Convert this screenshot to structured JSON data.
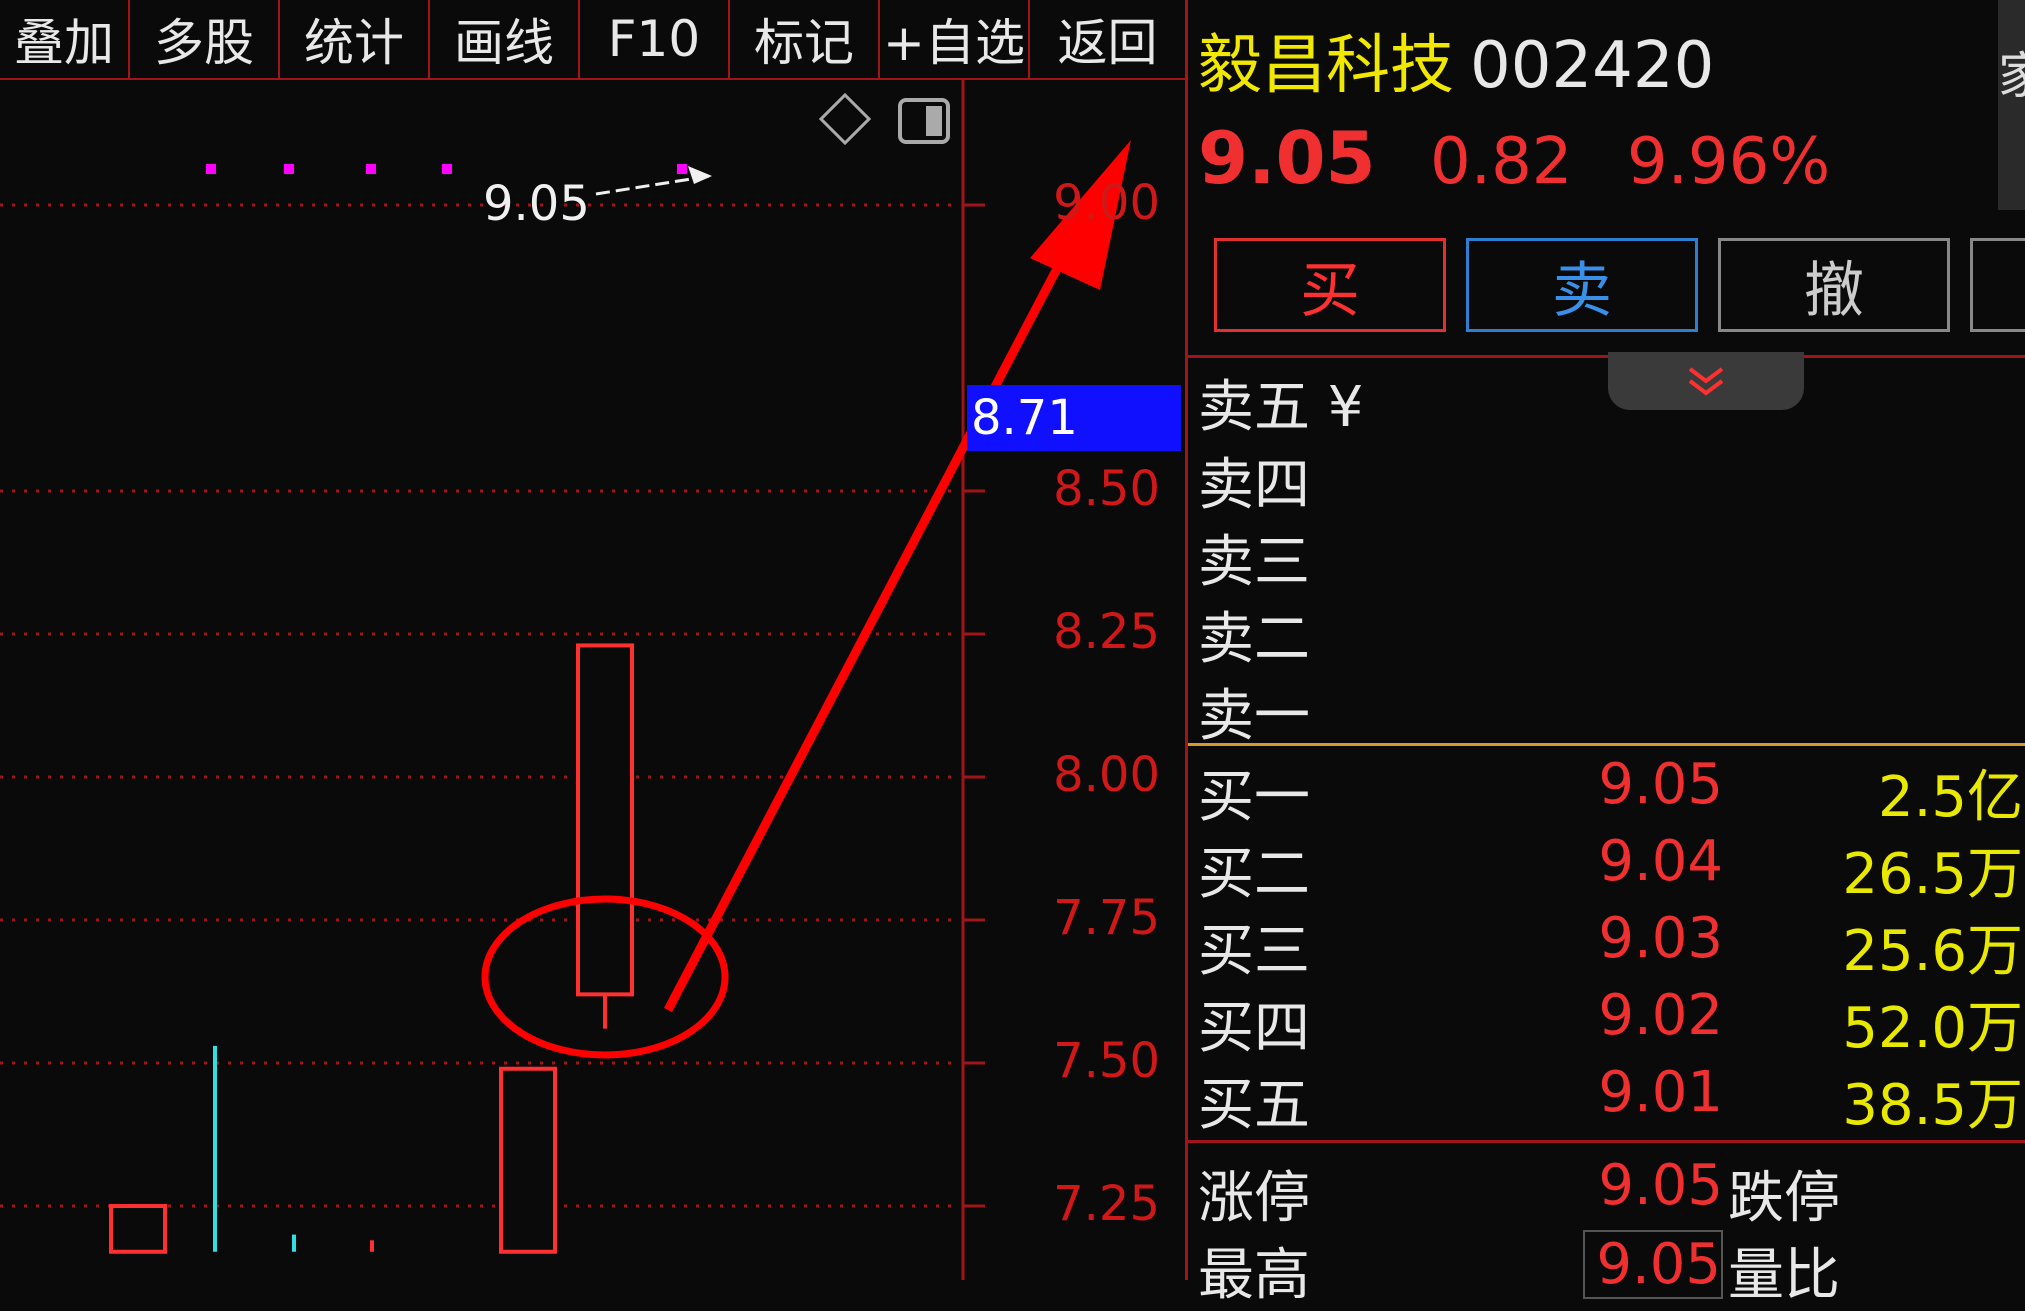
{
  "toolbar": {
    "items": [
      "叠加",
      "多股",
      "统计",
      "画线",
      "F10",
      "标记",
      "+自选",
      "返回"
    ]
  },
  "chart": {
    "price_label": "9.05",
    "current_price": "8.71",
    "axis": [
      "9.00",
      "8.50",
      "8.25",
      "8.00",
      "7.75",
      "7.50",
      "7.25"
    ],
    "colors": {
      "up": "#ff3030",
      "down": "#30e0e0",
      "accent": "#ff0000"
    }
  },
  "chart_data": {
    "type": "candlestick",
    "ylim": [
      7.17,
      9.1
    ],
    "yticks": [
      9.0,
      8.5,
      8.25,
      8.0,
      7.75,
      7.5,
      7.25
    ],
    "candles": [
      {
        "open": 7.25,
        "close": 7.17,
        "high": 7.25,
        "low": 7.17,
        "color": "up"
      },
      {
        "open": 7.53,
        "close": 7.17,
        "high": 7.53,
        "low": 7.17,
        "color": "down"
      },
      {
        "open": 7.17,
        "close": 7.17,
        "high": 7.2,
        "low": 7.17,
        "color": "down"
      },
      {
        "open": 7.17,
        "close": 7.17,
        "high": 7.19,
        "low": 7.17,
        "color": "up"
      },
      {
        "open": 7.17,
        "close": 7.49,
        "high": 7.49,
        "low": 7.17,
        "color": "up"
      },
      {
        "open": 7.62,
        "close": 8.23,
        "high": 8.23,
        "low": 7.56,
        "color": "up"
      }
    ],
    "limit_price": 9.05
  },
  "stock": {
    "name": "毅昌科技",
    "code": "002420",
    "price": "9.05",
    "change": "0.82",
    "change_pct": "9.96%"
  },
  "actions": {
    "buy": "买",
    "sell": "卖",
    "cancel": "撤"
  },
  "order_book": {
    "asks": [
      {
        "label": "卖五 ¥"
      },
      {
        "label": "卖四"
      },
      {
        "label": "卖三"
      },
      {
        "label": "卖二"
      },
      {
        "label": "卖一"
      }
    ],
    "bids": [
      {
        "label": "买一",
        "price": "9.05",
        "volume": "2.5亿"
      },
      {
        "label": "买二",
        "price": "9.04",
        "volume": "26.5万"
      },
      {
        "label": "买三",
        "price": "9.03",
        "volume": "25.6万"
      },
      {
        "label": "买四",
        "price": "9.02",
        "volume": "52.0万"
      },
      {
        "label": "买五",
        "price": "9.01",
        "volume": "38.5万"
      }
    ]
  },
  "stats": {
    "limit_up_label": "涨停",
    "limit_up_value": "9.05",
    "limit_down_label": "跌停",
    "high_label": "最高",
    "high_value": "9.05",
    "volume_ratio_label": "量比"
  },
  "edge": {
    "char": "家"
  }
}
